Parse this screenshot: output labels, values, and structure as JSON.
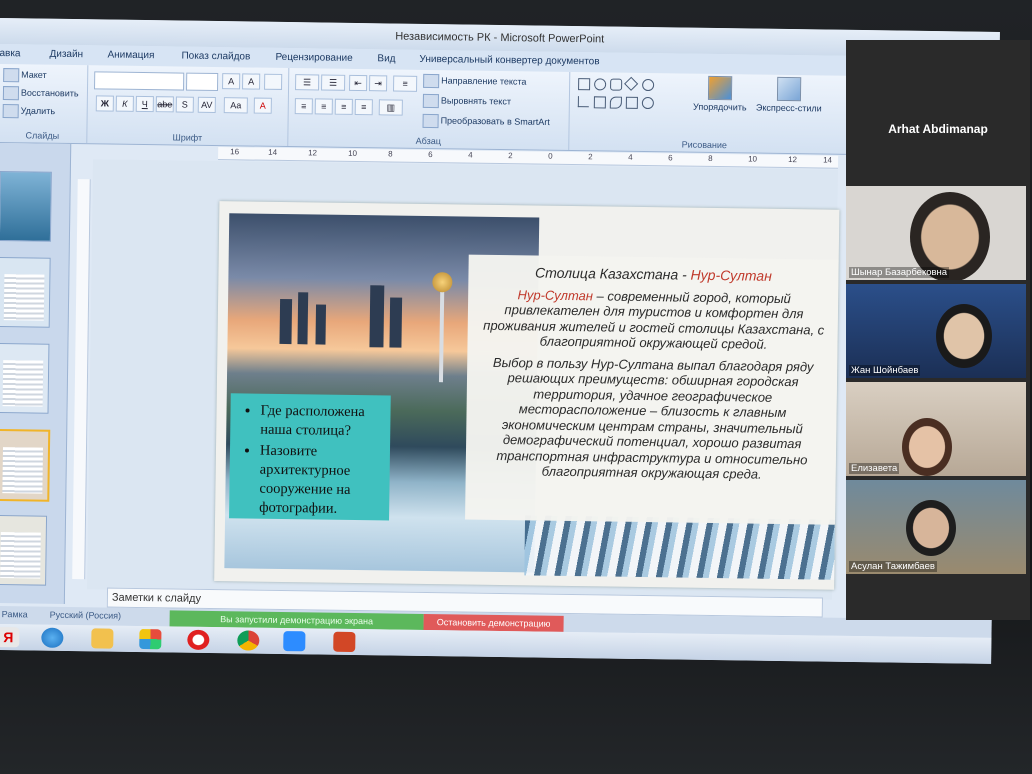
{
  "window": {
    "title": "Независимость РК - Microsoft PowerPoint"
  },
  "ribbon_tabs": [
    "авка",
    "Дизайн",
    "Анимация",
    "Показ слайдов",
    "Рецензирование",
    "Вид",
    "Универсальный конвертер документов"
  ],
  "ribbon": {
    "slides_group": {
      "layout": "Макет",
      "reset": "Восстановить",
      "delete": "Удалить",
      "label": "Слайды"
    },
    "font_group": {
      "label": "Шрифт",
      "bold": "Ж",
      "italic": "К",
      "underline": "Ч",
      "strike": "abe",
      "shadow": "S",
      "spacing": "AV",
      "case": "Aa",
      "grow": "A",
      "shrink": "A"
    },
    "paragraph_group": {
      "label": "Абзац",
      "text_direction": "Направление текста",
      "align_text": "Выровнять текст",
      "smartart": "Преобразовать в SmartArt"
    },
    "drawing_group": {
      "label": "Рисование",
      "arrange": "Упорядочить",
      "quick_styles": "Экспресс-стили"
    }
  },
  "ruler": {
    "marks": [
      "16",
      "14",
      "12",
      "10",
      "8",
      "6",
      "4",
      "2",
      "0",
      "2",
      "4",
      "6",
      "8",
      "10",
      "12",
      "14"
    ]
  },
  "slide": {
    "title_prefix": "Столица Казахстана -",
    "title_city": "Нур-Султан",
    "p1_city": "Нур-Султан",
    "p1_rest": "– современный город, который привлекателен для туристов и комфортен для проживания жителей и гостей столицы Казахстана, с благоприятной окружающей средой.",
    "p2": "Выбор в пользу Нур-Султана выпал благодаря ряду решающих преимуществ: обширная городская территория, удачное географическое месторасположение – близость к главным экономическим центрам страны, значительный демографический потенциал, хорошо развитая транспортная инфраструктура и относительно благоприятная окружающая среда.",
    "questions": [
      "Где расположена наша столица?",
      "Назовите архитектурное сооружение на фотографии."
    ]
  },
  "notes_placeholder": "Заметки к слайду",
  "status": {
    "view": "Рамка",
    "language": "Русский (Россия)"
  },
  "share": {
    "sharing_text": "Вы запустили демонстрацию экрана",
    "stop_label": "Остановить демонстрацию"
  },
  "zoom": {
    "speaker": "Arhat Abdimanap",
    "participants": [
      {
        "name": "Шынар Базарбековна",
        "bg": "#d9d6d2"
      },
      {
        "name": "Жан Шойнбаев",
        "bg": "#3a5a8c"
      },
      {
        "name": "Елизавета",
        "bg": "#cbbfb0"
      },
      {
        "name": "Асулан Тажимбаев",
        "bg": "#6f8a9c"
      }
    ]
  },
  "taskbar_icons": [
    "yandex-icon",
    "ie-icon",
    "folder-icon",
    "windows-icon",
    "opera-icon",
    "chrome-icon",
    "zoom-icon",
    "powerpoint-icon"
  ],
  "colors": {
    "teal": "#40c1bf",
    "accent_red": "#c0392b",
    "share_green": "#5cb85c",
    "stop_red": "#e05a5a"
  }
}
